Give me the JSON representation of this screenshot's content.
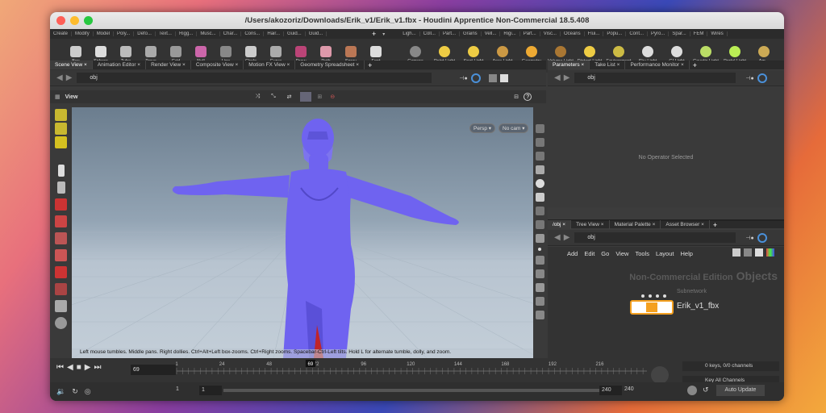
{
  "title": "/Users/akozoriz/Downloads/Erik_v1/Erik_v1.fbx - Houdini Apprentice Non-Commercial 18.5.408",
  "shelf_tabs_left": [
    "Create",
    "Modify",
    "Model",
    "Poly...",
    "Defo...",
    "Text...",
    "Rigg...",
    "Musc...",
    "Char...",
    "Cons...",
    "Hair...",
    "Guid...",
    "Guid..."
  ],
  "shelf_tabs_right": [
    "Ligh...",
    "Coll...",
    "Part...",
    "Grains",
    "Vell...",
    "Rigi...",
    "Part...",
    "Visc...",
    "Oceans",
    "Flui...",
    "Popu...",
    "Cont...",
    "Pyro...",
    "Spar...",
    "FEM",
    "Wires"
  ],
  "tools_left": [
    "Box",
    "Sphere",
    "Tube",
    "Torus",
    "Grid",
    "Null",
    "Line",
    "Circle",
    "Curve",
    "Draw Curve",
    "Path",
    "Spray Paint",
    "Font"
  ],
  "tools_right": [
    "Camera",
    "Point Light",
    "Spot Light",
    "Area Light",
    "Geometry Light",
    "Volume Light",
    "Distant Light",
    "Environment Light",
    "Sky Light",
    "GI Light",
    "Caustic Light",
    "Portal Light",
    "Am..."
  ],
  "left_tabs": [
    "Scene View",
    "Animation Editor",
    "Render View",
    "Composite View",
    "Motion FX View",
    "Geometry Spreadsheet"
  ],
  "right_tabs_top": [
    "Parameters",
    "Take List",
    "Performance Monitor"
  ],
  "right_tabs_bottom": [
    "/obj",
    "Tree View",
    "Material Palette",
    "Asset Browser"
  ],
  "path": "obj",
  "view_label": "View",
  "persp": "Persp ▾",
  "cam": "No cam ▾",
  "status": "Left mouse tumbles. Middle pans. Right dollies. Ctrl+Alt+Left box-zooms. Ctrl+Right zooms. Spacebar-Ctrl-Left tilts. Hold L for alternate tumble, dolly, and zoom.",
  "no_op": "No Operator Selected",
  "net_menu": [
    "Add",
    "Edit",
    "Go",
    "View",
    "Tools",
    "Layout",
    "Help"
  ],
  "watermark": "Non-Commercial Edition",
  "objects": "Objects",
  "node_type": "Subnetwork",
  "node_name": "Erik_v1_fbx",
  "frame": "69",
  "ticks": [
    "1",
    "24",
    "48",
    "72",
    "96",
    "120",
    "144",
    "168",
    "192",
    "216"
  ],
  "current_frame_marker": "69",
  "range_start": "1",
  "range_start2": "1",
  "range_end": "240",
  "range_end2": "240",
  "keys": "0 keys, 0/0 channels",
  "key_all": "Key All Channels",
  "auto_update": "Auto Update",
  "colors": {
    "model": "#6f63f0",
    "accent": "#f4a020"
  }
}
